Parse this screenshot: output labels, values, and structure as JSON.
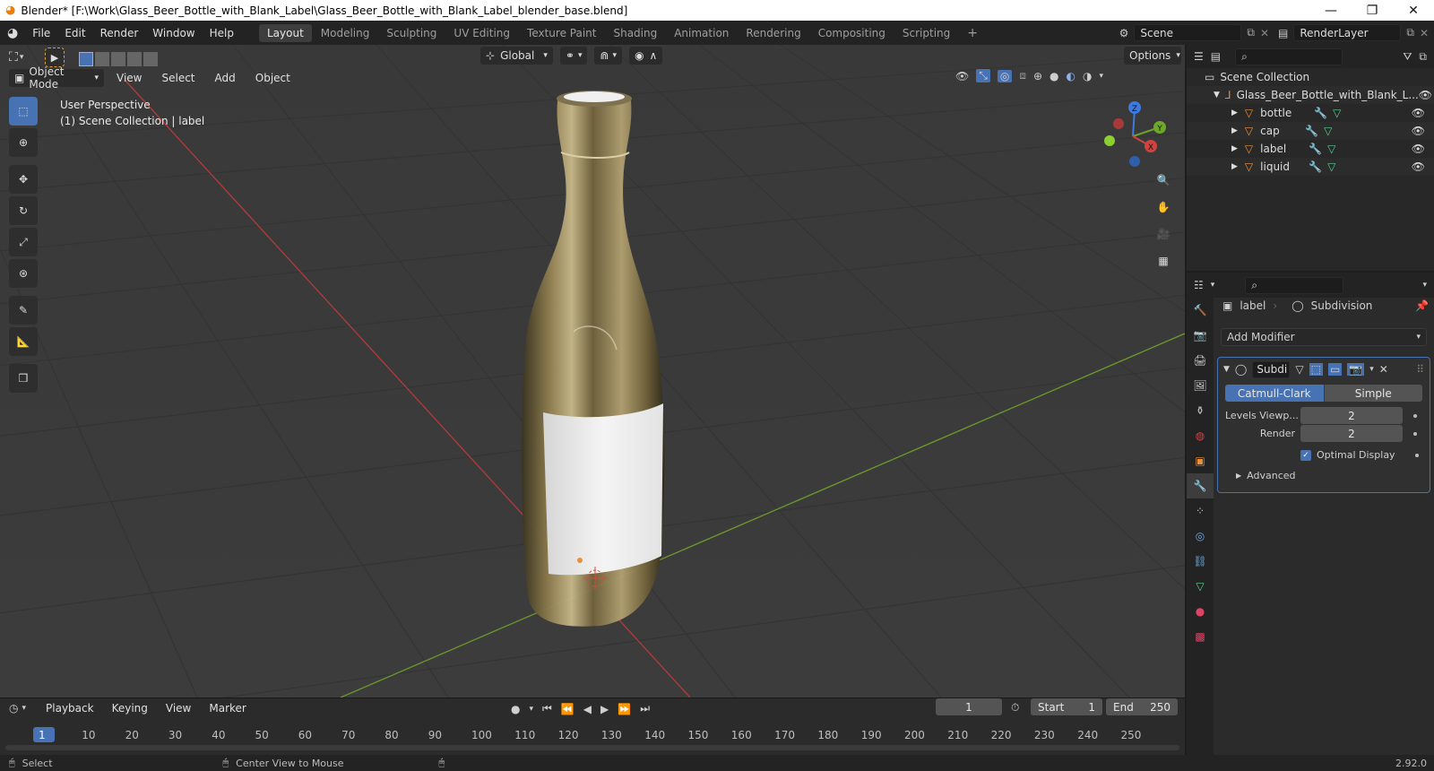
{
  "window": {
    "title": "Blender* [F:\\Work\\Glass_Beer_Bottle_with_Blank_Label\\Glass_Beer_Bottle_with_Blank_Label_blender_base.blend]"
  },
  "menu": [
    "File",
    "Edit",
    "Render",
    "Window",
    "Help"
  ],
  "workspaces": [
    "Layout",
    "Modeling",
    "Sculpting",
    "UV Editing",
    "Texture Paint",
    "Shading",
    "Animation",
    "Rendering",
    "Compositing",
    "Scripting"
  ],
  "active_workspace": "Layout",
  "scene": {
    "name": "Scene",
    "render_layer": "RenderLayer"
  },
  "viewport": {
    "transform_orientation": "Global",
    "options_label": "Options",
    "mode": "Object Mode",
    "menus": [
      "View",
      "Select",
      "Add",
      "Object"
    ],
    "overlay_title": "User Perspective",
    "overlay_subtitle": "(1) Scene Collection | label",
    "gizmo_axes": {
      "x": "X",
      "y": "Y",
      "z": "Z"
    }
  },
  "outliner": {
    "root": "Scene Collection",
    "collection": "Glass_Beer_Bottle_with_Blank_L...",
    "objects": [
      "bottle",
      "cap",
      "label",
      "liquid"
    ]
  },
  "properties": {
    "object_name": "label",
    "modifier_name": "Subdivision",
    "add_modifier": "Add Modifier",
    "modifier_short": "Subdi",
    "algorithms": [
      "Catmull-Clark",
      "Simple"
    ],
    "active_algorithm": "Catmull-Clark",
    "levels_viewport_label": "Levels Viewp...",
    "levels_viewport": "2",
    "render_label": "Render",
    "render_levels": "2",
    "optimal_display": "Optimal Display",
    "advanced": "Advanced"
  },
  "timeline": {
    "menus": [
      "Playback",
      "Keying",
      "View",
      "Marker"
    ],
    "current_frame": "1",
    "start_label": "Start",
    "start": "1",
    "end_label": "End",
    "end": "250",
    "ruler": [
      "1",
      "10",
      "20",
      "30",
      "40",
      "50",
      "60",
      "70",
      "80",
      "90",
      "100",
      "110",
      "120",
      "130",
      "140",
      "150",
      "160",
      "170",
      "180",
      "190",
      "200",
      "210",
      "220",
      "230",
      "240",
      "250"
    ]
  },
  "statusbar": {
    "select": "Select",
    "center_view": "Center View to Mouse",
    "version": "2.92.0"
  },
  "colors": {
    "accent": "#4772b3",
    "x_axis": "#d2433f",
    "y_axis": "#6da82b",
    "z_axis": "#3d7be0",
    "object_orange": "#e8913a"
  }
}
